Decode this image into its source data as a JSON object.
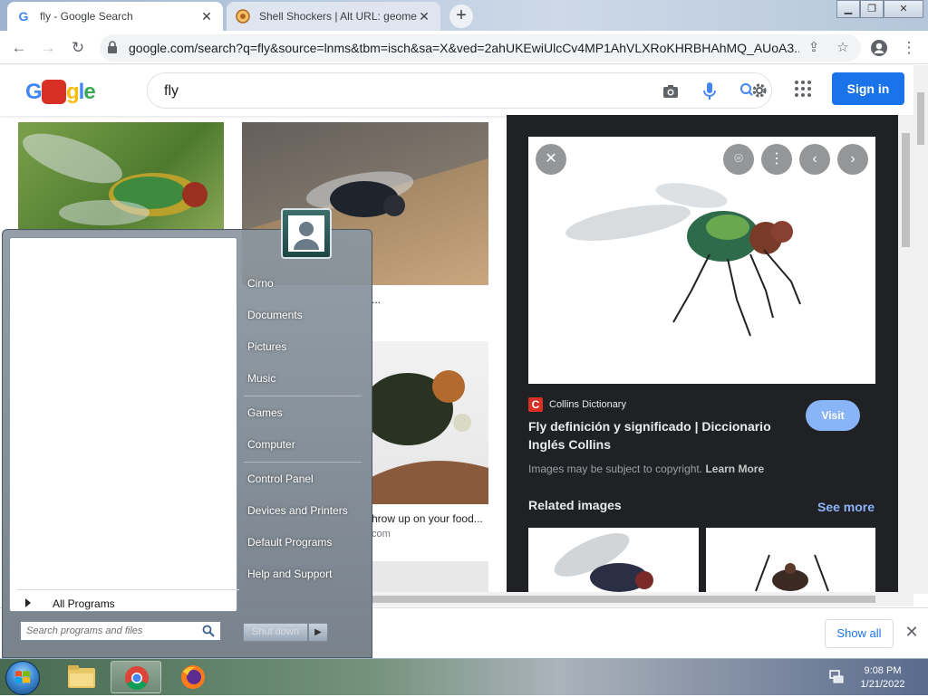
{
  "browser": {
    "tabs": [
      {
        "title": "fly - Google Search",
        "active": true
      },
      {
        "title": "Shell Shockers | Alt URL: geometry",
        "active": false
      }
    ],
    "url": "google.com/search?q=fly&source=lnms&tbm=isch&sa=X&ved=2ahUKEwiUlcCv4MP1AhVLXRoKHRBHAhMQ_AUoA3..."
  },
  "google": {
    "logo": "Google",
    "query": "fly",
    "sign_in": "Sign in"
  },
  "results": {
    "captions": [
      {
        "text": "...",
        "source": ""
      },
      {
        "text": "hrow up on your food...",
        "source": "com"
      }
    ]
  },
  "preview": {
    "source_name": "Collins Dictionary",
    "title": "Fly definición y significado | Diccionario Inglés Collins",
    "visit": "Visit",
    "copyright": "Images may be subject to copyright.",
    "learn_more": "Learn More",
    "related": "Related images",
    "see_more": "See more"
  },
  "download_bar": {
    "show_all": "Show all"
  },
  "start_menu": {
    "items": [
      "Cirno",
      "Documents",
      "Pictures",
      "Music",
      "Games",
      "Computer",
      "Control Panel",
      "Devices and Printers",
      "Default Programs",
      "Help and Support"
    ],
    "all_programs": "All Programs",
    "search_placeholder": "Search programs and files",
    "shutdown": "Shut down"
  },
  "taskbar": {
    "time": "9:08 PM",
    "date": "1/21/2022"
  },
  "colors": {
    "accent_blue": "#1a73e8",
    "preview_bg": "#202124",
    "visit_button": "#8ab4f8",
    "collins_red": "#d93025"
  }
}
